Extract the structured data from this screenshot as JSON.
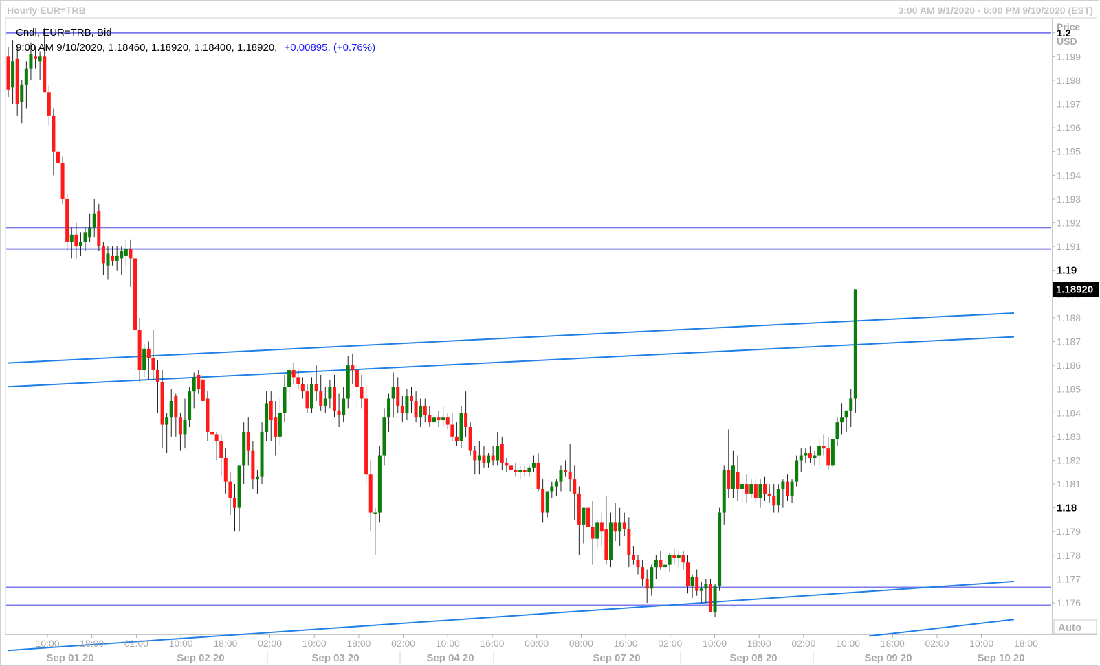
{
  "header": {
    "title": "Hourly EUR=TRB",
    "range": "3:00 AM 9/1/2020 - 6:00 PM 9/10/2020 (EST)"
  },
  "info": {
    "line1": "Cndl, EUR=TRB, Bid",
    "line2_ohlc": "9:00 AM 9/10/2020, 1.18460, 1.18920, 1.18400, 1.18920,",
    "line2_change": "+0.00895, (+0.76%)"
  },
  "axis": {
    "title_line1": "Price",
    "title_line2": "USD",
    "auto_label": "Auto",
    "last_price_label": "1.18920"
  },
  "colors": {
    "up": "#0a7d0a",
    "down": "#ff1a1a",
    "hline": "#7a7aee",
    "trend": "#1e7fe6",
    "badge": "#000000"
  },
  "chart_data": {
    "type": "candlestick",
    "instrument": "EUR=TRB",
    "interval": "Hourly",
    "ylim": [
      1.1747,
      1.2006
    ],
    "y_ticks": [
      "1.2",
      "1.199",
      "1.198",
      "1.197",
      "1.196",
      "1.195",
      "1.194",
      "1.193",
      "1.192",
      "1.191",
      "1.19",
      "1.189",
      "1.188",
      "1.187",
      "1.186",
      "1.185",
      "1.184",
      "1.183",
      "1.182",
      "1.181",
      "1.18",
      "1.179",
      "1.178",
      "1.177",
      "1.176"
    ],
    "y_major_ticks": [
      "1.2",
      "1.19",
      "1.18"
    ],
    "x_time_ticks": [
      "10:00",
      "18:00",
      "02:00",
      "10:00",
      "18:00",
      "02:00",
      "10:00",
      "18:00",
      "02:00",
      "10:00",
      "16:00",
      "00:00",
      "08:00",
      "16:00",
      "02:00",
      "10:00",
      "18:00",
      "02:00",
      "10:00",
      "18:00",
      "02:00",
      "10:00",
      "18:00"
    ],
    "x_day_labels": [
      "Sep 01 20",
      "Sep 02 20",
      "Sep 03 20",
      "Sep 04 20",
      "Sep 07 20",
      "Sep 08 20",
      "Sep 09 20",
      "Sep 10 20"
    ],
    "horizontal_lines": [
      1.2,
      1.1918,
      1.1909,
      1.17665,
      1.1759
    ],
    "trend_lines": [
      {
        "from_index": 0,
        "from": 1.1861,
        "to_index": 222,
        "to": 1.1882
      },
      {
        "from_index": 0,
        "from": 1.1851,
        "to_index": 222,
        "to": 1.1872
      },
      {
        "from_index": 0,
        "from": 1.174,
        "to_index": 222,
        "to": 1.1769
      },
      {
        "from_index": 190,
        "from": 1.1746,
        "to_index": 222,
        "to": 1.1753
      }
    ],
    "candles": [
      [
        1.199,
        1.1994,
        1.1973,
        1.1976
      ],
      [
        1.1977,
        1.1997,
        1.197,
        1.1988
      ],
      [
        1.1989,
        1.1995,
        1.1965,
        1.197
      ],
      [
        1.1971,
        1.198,
        1.1962,
        1.1978
      ],
      [
        1.1978,
        1.1988,
        1.1968,
        1.1985
      ],
      [
        1.1985,
        1.1996,
        1.198,
        1.1991
      ],
      [
        1.199,
        1.1994,
        1.1985,
        1.1989
      ],
      [
        1.1988,
        1.1992,
        1.198,
        1.199
      ],
      [
        1.199,
        1.2002,
        1.1978,
        1.1975
      ],
      [
        1.1975,
        1.1978,
        1.1961,
        1.1965
      ],
      [
        1.1965,
        1.1968,
        1.194,
        1.195
      ],
      [
        1.195,
        1.1953,
        1.1936,
        1.1945
      ],
      [
        1.1945,
        1.1948,
        1.1928,
        1.193
      ],
      [
        1.193,
        1.1932,
        1.1908,
        1.1912
      ],
      [
        1.1912,
        1.1918,
        1.1905,
        1.1915
      ],
      [
        1.1915,
        1.192,
        1.1905,
        1.191
      ],
      [
        1.191,
        1.1916,
        1.1906,
        1.1912
      ],
      [
        1.1912,
        1.1918,
        1.1908,
        1.1916
      ],
      [
        1.1914,
        1.1924,
        1.1912,
        1.1918
      ],
      [
        1.1918,
        1.193,
        1.1914,
        1.1924
      ],
      [
        1.1925,
        1.1928,
        1.1908,
        1.191
      ],
      [
        1.191,
        1.1912,
        1.1898,
        1.1903
      ],
      [
        1.1902,
        1.191,
        1.1896,
        1.1907
      ],
      [
        1.1906,
        1.191,
        1.1902,
        1.1904
      ],
      [
        1.1904,
        1.191,
        1.19,
        1.1906
      ],
      [
        1.1905,
        1.191,
        1.1898,
        1.1908
      ],
      [
        1.1906,
        1.1913,
        1.1902,
        1.1909
      ],
      [
        1.1909,
        1.1913,
        1.1893,
        1.1905
      ],
      [
        1.1905,
        1.1906,
        1.188,
        1.1875
      ],
      [
        1.1875,
        1.188,
        1.1853,
        1.1858
      ],
      [
        1.1858,
        1.1869,
        1.1855,
        1.1867
      ],
      [
        1.1867,
        1.187,
        1.1854,
        1.1863
      ],
      [
        1.1863,
        1.1875,
        1.1854,
        1.1858
      ],
      [
        1.1858,
        1.1862,
        1.184,
        1.1853
      ],
      [
        1.1853,
        1.1858,
        1.1825,
        1.1835
      ],
      [
        1.1835,
        1.184,
        1.1823,
        1.1838
      ],
      [
        1.1838,
        1.185,
        1.183,
        1.1845
      ],
      [
        1.1847,
        1.1848,
        1.183,
        1.1838
      ],
      [
        1.1838,
        1.184,
        1.1824,
        1.1831
      ],
      [
        1.1831,
        1.1846,
        1.1825,
        1.1837
      ],
      [
        1.1837,
        1.1851,
        1.1834,
        1.1849
      ],
      [
        1.1849,
        1.1857,
        1.1842,
        1.1855
      ],
      [
        1.1856,
        1.1858,
        1.1848,
        1.185
      ],
      [
        1.1854,
        1.1856,
        1.1844,
        1.1845
      ],
      [
        1.1846,
        1.1849,
        1.1828,
        1.1832
      ],
      [
        1.1832,
        1.1838,
        1.1825,
        1.1831
      ],
      [
        1.1831,
        1.1832,
        1.182,
        1.1828
      ],
      [
        1.1828,
        1.1831,
        1.1813,
        1.1821
      ],
      [
        1.1821,
        1.1825,
        1.1806,
        1.1811
      ],
      [
        1.1811,
        1.1815,
        1.1797,
        1.1804
      ],
      [
        1.1804,
        1.181,
        1.179,
        1.18
      ],
      [
        1.18,
        1.1814,
        1.179,
        1.1818
      ],
      [
        1.1818,
        1.1836,
        1.181,
        1.1832
      ],
      [
        1.1832,
        1.1838,
        1.1818,
        1.1824
      ],
      [
        1.1824,
        1.1828,
        1.1808,
        1.1812
      ],
      [
        1.1812,
        1.1816,
        1.1806,
        1.1813
      ],
      [
        1.1813,
        1.1836,
        1.181,
        1.1832
      ],
      [
        1.1832,
        1.1849,
        1.1828,
        1.1844
      ],
      [
        1.1845,
        1.1849,
        1.1828,
        1.1837
      ],
      [
        1.1838,
        1.1845,
        1.1822,
        1.183
      ],
      [
        1.183,
        1.1846,
        1.1826,
        1.184
      ],
      [
        1.184,
        1.1856,
        1.1836,
        1.1851
      ],
      [
        1.1851,
        1.1859,
        1.1846,
        1.1858
      ],
      [
        1.1858,
        1.1861,
        1.1852,
        1.1855
      ],
      [
        1.1855,
        1.1858,
        1.185,
        1.1852
      ],
      [
        1.1852,
        1.1855,
        1.1846,
        1.1849
      ],
      [
        1.1849,
        1.1852,
        1.184,
        1.1842
      ],
      [
        1.1842,
        1.1855,
        1.184,
        1.1852
      ],
      [
        1.1852,
        1.186,
        1.1845,
        1.1849
      ],
      [
        1.1849,
        1.1856,
        1.1841,
        1.1843
      ],
      [
        1.1843,
        1.1851,
        1.184,
        1.1846
      ],
      [
        1.1846,
        1.1854,
        1.1842,
        1.1851
      ],
      [
        1.1851,
        1.1856,
        1.1838,
        1.1841
      ],
      [
        1.1841,
        1.1848,
        1.1834,
        1.1839
      ],
      [
        1.1839,
        1.1851,
        1.1836,
        1.1846
      ],
      [
        1.1846,
        1.1864,
        1.1842,
        1.186
      ],
      [
        1.186,
        1.1865,
        1.1852,
        1.1858
      ],
      [
        1.1858,
        1.1861,
        1.1842,
        1.1851
      ],
      [
        1.1851,
        1.1856,
        1.1842,
        1.1846
      ],
      [
        1.1846,
        1.1852,
        1.181,
        1.1814
      ],
      [
        1.1814,
        1.182,
        1.179,
        1.1798
      ],
      [
        1.1798,
        1.18,
        1.178,
        1.1798
      ],
      [
        1.1798,
        1.1826,
        1.1794,
        1.1822
      ],
      [
        1.1822,
        1.1842,
        1.1818,
        1.1838
      ],
      [
        1.1838,
        1.1848,
        1.1832,
        1.1846
      ],
      [
        1.1846,
        1.1857,
        1.1838,
        1.1851
      ],
      [
        1.1851,
        1.1855,
        1.184,
        1.1843
      ],
      [
        1.1843,
        1.1847,
        1.1836,
        1.184
      ],
      [
        1.184,
        1.185,
        1.1837,
        1.1847
      ],
      [
        1.1847,
        1.1851,
        1.184,
        1.1845
      ],
      [
        1.1845,
        1.1849,
        1.1836,
        1.1838
      ],
      [
        1.1838,
        1.1846,
        1.1834,
        1.1843
      ],
      [
        1.1843,
        1.1846,
        1.1836,
        1.1839
      ],
      [
        1.1839,
        1.1843,
        1.1834,
        1.1836
      ],
      [
        1.1836,
        1.1839,
        1.1833,
        1.1838
      ],
      [
        1.1838,
        1.1841,
        1.1834,
        1.1837
      ],
      [
        1.1837,
        1.1843,
        1.1834,
        1.1838
      ],
      [
        1.1838,
        1.184,
        1.1833,
        1.1835
      ],
      [
        1.1835,
        1.184,
        1.1828,
        1.183
      ],
      [
        1.183,
        1.1836,
        1.1826,
        1.1828
      ],
      [
        1.1828,
        1.1843,
        1.1825,
        1.184
      ],
      [
        1.184,
        1.1849,
        1.183,
        1.1834
      ],
      [
        1.1834,
        1.1836,
        1.1822,
        1.1824
      ],
      [
        1.1824,
        1.1826,
        1.1814,
        1.182
      ],
      [
        1.182,
        1.1828,
        1.1814,
        1.1822
      ],
      [
        1.1822,
        1.1826,
        1.1817,
        1.1819
      ],
      [
        1.1819,
        1.1823,
        1.1817,
        1.1822
      ],
      [
        1.1822,
        1.1826,
        1.1818,
        1.182
      ],
      [
        1.182,
        1.1832,
        1.1818,
        1.1826
      ],
      [
        1.1827,
        1.183,
        1.1816,
        1.1819
      ],
      [
        1.1819,
        1.1821,
        1.1815,
        1.1818
      ],
      [
        1.1818,
        1.182,
        1.1813,
        1.1816
      ],
      [
        1.1816,
        1.1819,
        1.1813,
        1.1815
      ],
      [
        1.1815,
        1.1818,
        1.1812,
        1.1816
      ],
      [
        1.1816,
        1.1818,
        1.1813,
        1.1815
      ],
      [
        1.1815,
        1.1818,
        1.1813,
        1.1817
      ],
      [
        1.1817,
        1.1822,
        1.1815,
        1.1819
      ],
      [
        1.1819,
        1.1823,
        1.1807,
        1.1808
      ],
      [
        1.1808,
        1.1812,
        1.1794,
        1.1798
      ],
      [
        1.1798,
        1.1805,
        1.1796,
        1.1807
      ],
      [
        1.1807,
        1.1811,
        1.1804,
        1.1809
      ],
      [
        1.1809,
        1.1812,
        1.1805,
        1.1811
      ],
      [
        1.1811,
        1.1818,
        1.1807,
        1.1816
      ],
      [
        1.1816,
        1.182,
        1.1813,
        1.1815
      ],
      [
        1.1815,
        1.1827,
        1.1807,
        1.1812
      ],
      [
        1.1812,
        1.1818,
        1.1795,
        1.1806
      ],
      [
        1.1806,
        1.1809,
        1.178,
        1.1793
      ],
      [
        1.1793,
        1.18,
        1.1785,
        1.18
      ],
      [
        1.18,
        1.1803,
        1.1788,
        1.1792
      ],
      [
        1.1792,
        1.1803,
        1.1776,
        1.1787
      ],
      [
        1.1787,
        1.1795,
        1.1783,
        1.1794
      ],
      [
        1.1794,
        1.1798,
        1.1784,
        1.179
      ],
      [
        1.1791,
        1.1805,
        1.1776,
        1.1778
      ],
      [
        1.1778,
        1.1798,
        1.1775,
        1.1794
      ],
      [
        1.1794,
        1.1802,
        1.1786,
        1.179
      ],
      [
        1.179,
        1.18,
        1.1784,
        1.1794
      ],
      [
        1.1794,
        1.1798,
        1.1788,
        1.1791
      ],
      [
        1.1791,
        1.1796,
        1.1775,
        1.178
      ],
      [
        1.178,
        1.1784,
        1.1776,
        1.1778
      ],
      [
        1.1778,
        1.178,
        1.1772,
        1.1775
      ],
      [
        1.1775,
        1.1778,
        1.1767,
        1.177
      ],
      [
        1.177,
        1.1774,
        1.176,
        1.1766
      ],
      [
        1.1766,
        1.1776,
        1.1763,
        1.1775
      ],
      [
        1.1775,
        1.178,
        1.177,
        1.1778
      ],
      [
        1.1778,
        1.1782,
        1.1774,
        1.1775
      ],
      [
        1.1775,
        1.1779,
        1.1772,
        1.1776
      ],
      [
        1.1776,
        1.1781,
        1.1773,
        1.178
      ],
      [
        1.178,
        1.1783,
        1.1776,
        1.1779
      ],
      [
        1.1779,
        1.1782,
        1.1775,
        1.178
      ],
      [
        1.178,
        1.1782,
        1.1774,
        1.1777
      ],
      [
        1.1777,
        1.178,
        1.1764,
        1.1767
      ],
      [
        1.1767,
        1.1772,
        1.1762,
        1.1771
      ],
      [
        1.1771,
        1.1774,
        1.1763,
        1.1765
      ],
      [
        1.1765,
        1.1769,
        1.176,
        1.1766
      ],
      [
        1.1766,
        1.177,
        1.176,
        1.1768
      ],
      [
        1.1768,
        1.177,
        1.1758,
        1.1756
      ],
      [
        1.1756,
        1.1768,
        1.1754,
        1.1767
      ],
      [
        1.1767,
        1.18,
        1.1765,
        1.1798
      ],
      [
        1.1798,
        1.1818,
        1.1793,
        1.1816
      ],
      [
        1.1816,
        1.1833,
        1.1804,
        1.1808
      ],
      [
        1.1808,
        1.1824,
        1.1804,
        1.1818
      ],
      [
        1.1815,
        1.1822,
        1.1803,
        1.1808
      ],
      [
        1.1808,
        1.1814,
        1.1802,
        1.181
      ],
      [
        1.181,
        1.1814,
        1.1802,
        1.1806
      ],
      [
        1.1806,
        1.1812,
        1.1804,
        1.181
      ],
      [
        1.181,
        1.1812,
        1.1802,
        1.1804
      ],
      [
        1.1804,
        1.1812,
        1.18,
        1.181
      ],
      [
        1.181,
        1.1813,
        1.1803,
        1.1806
      ],
      [
        1.1806,
        1.181,
        1.1802,
        1.1805
      ],
      [
        1.1805,
        1.181,
        1.1798,
        1.1801
      ],
      [
        1.1801,
        1.181,
        1.1798,
        1.1808
      ],
      [
        1.1808,
        1.1812,
        1.18,
        1.1811
      ],
      [
        1.1811,
        1.1814,
        1.1803,
        1.1805
      ],
      [
        1.1805,
        1.1812,
        1.1802,
        1.1811
      ],
      [
        1.1811,
        1.1822,
        1.1809,
        1.182
      ],
      [
        1.182,
        1.1825,
        1.1815,
        1.1822
      ],
      [
        1.1822,
        1.1825,
        1.1819,
        1.1823
      ],
      [
        1.1823,
        1.1826,
        1.1819,
        1.1821
      ],
      [
        1.1821,
        1.1824,
        1.1818,
        1.1822
      ],
      [
        1.1822,
        1.1829,
        1.1818,
        1.1826
      ],
      [
        1.1826,
        1.1831,
        1.1822,
        1.1825
      ],
      [
        1.1825,
        1.183,
        1.1816,
        1.1818
      ],
      [
        1.1818,
        1.183,
        1.1817,
        1.1829
      ],
      [
        1.1829,
        1.1838,
        1.1826,
        1.1836
      ],
      [
        1.1836,
        1.1844,
        1.1831,
        1.1838
      ],
      [
        1.1838,
        1.184,
        1.1832,
        1.1841
      ],
      [
        1.1841,
        1.185,
        1.1834,
        1.1846
      ],
      [
        1.1846,
        1.1892,
        1.184,
        1.1892
      ]
    ]
  }
}
